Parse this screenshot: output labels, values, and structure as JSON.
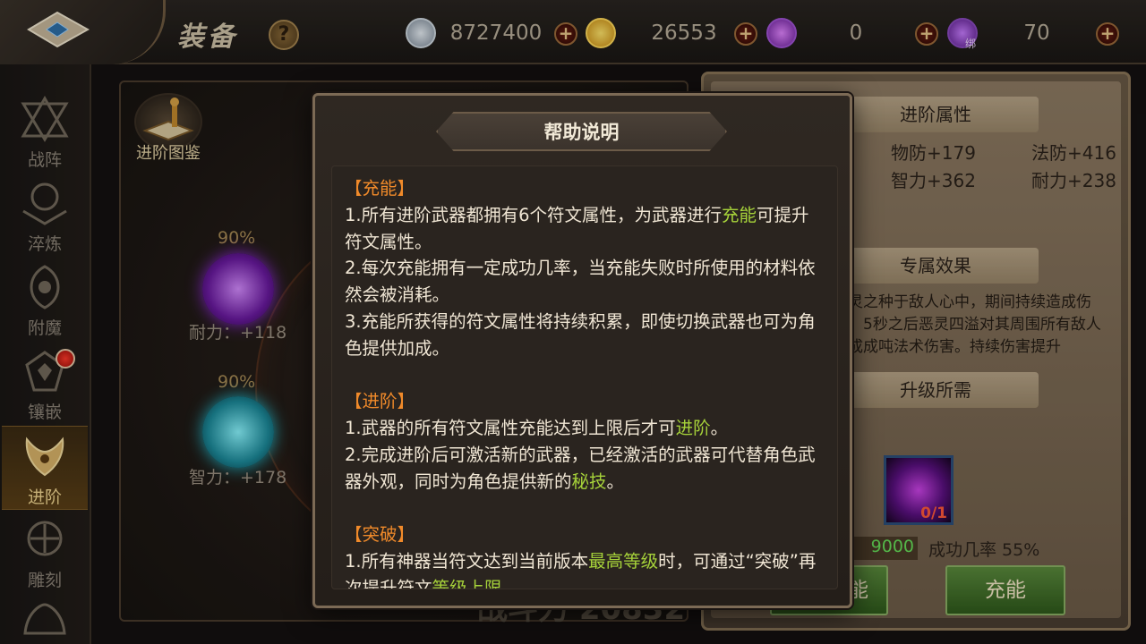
{
  "header": {
    "title": "装备",
    "help_glyph": "?",
    "currencies": [
      {
        "name": "silver",
        "value": "8727400"
      },
      {
        "name": "gold",
        "value": "26553"
      },
      {
        "name": "soul",
        "value": "0"
      },
      {
        "name": "soul_bound",
        "value": "70",
        "tag": "绑"
      }
    ],
    "plus_glyph": "+"
  },
  "sidebar": {
    "items": [
      {
        "label": "战阵",
        "icon": "formation-icon",
        "active": false
      },
      {
        "label": "淬炼",
        "icon": "temper-icon",
        "active": false
      },
      {
        "label": "附魔",
        "icon": "enchant-icon",
        "active": false
      },
      {
        "label": "镶嵌",
        "icon": "inlay-icon",
        "active": false,
        "badge": true
      },
      {
        "label": "进阶",
        "icon": "advance-icon",
        "active": true
      },
      {
        "label": "雕刻",
        "icon": "engrave-icon",
        "active": false
      }
    ]
  },
  "center": {
    "book_label": "进阶图鉴",
    "runes": [
      {
        "percent": "90%",
        "stat": "耐力：+118",
        "color": "purple"
      },
      {
        "percent": "90%",
        "stat": "智力：+178",
        "color": "cyan"
      }
    ],
    "power_partial": "战斗力 20832"
  },
  "right": {
    "advance_attr_title": "进阶属性",
    "stats": [
      "物防+179",
      "法防+416",
      "智力+362",
      "耐力+238"
    ],
    "exclusive_title": "专属效果",
    "exclusive_text": "恶灵之种于敌人心中，期间持续造成伤害，5秒之后恶灵四溢对其周围所有敌人造成成吨法术伤害。持续伤害提升",
    "upgrade_title": "升级所需",
    "item_count": "0/1",
    "cost_partial": "9000",
    "success_rate": "成功几率 55%",
    "btn_left_partial": "能",
    "btn_charge": "充能"
  },
  "modal": {
    "title": "帮助说明",
    "sections": [
      {
        "title": "【充能】",
        "lines": [
          [
            {
              "t": "1.所有进阶武器都拥有6个符文属性，为武器进行"
            },
            {
              "t": "充能",
              "hl": true
            },
            {
              "t": "可提升符文属性。"
            }
          ],
          [
            {
              "t": "2.每次充能拥有一定成功几率，当充能失败时所使用的材料依然会被消耗。"
            }
          ],
          [
            {
              "t": "3.充能所获得的符文属性将持续积累，即使切换武器也可为角色提供加成。"
            }
          ]
        ]
      },
      {
        "title": "【进阶】",
        "lines": [
          [
            {
              "t": "1.武器的所有符文属性充能达到上限后才可"
            },
            {
              "t": "进阶",
              "hl": true
            },
            {
              "t": "。"
            }
          ],
          [
            {
              "t": "2.完成进阶后可激活新的武器，已经激活的武器可代替角色武器外观，同时为角色提供新的"
            },
            {
              "t": "秘技",
              "hl": true
            },
            {
              "t": "。"
            }
          ]
        ]
      },
      {
        "title": "【突破】",
        "lines": [
          [
            {
              "t": "1.所有神器当符文达到当前版本"
            },
            {
              "t": "最高等级",
              "hl": true
            },
            {
              "t": "时，可通过“突破”再次提升符文"
            },
            {
              "t": "等级上限",
              "hl": true
            },
            {
              "t": "。"
            }
          ]
        ]
      }
    ]
  },
  "colors": {
    "section_title": "#f08a2a",
    "highlight": "#a6d23a",
    "body_text": "#f0e6d4"
  }
}
